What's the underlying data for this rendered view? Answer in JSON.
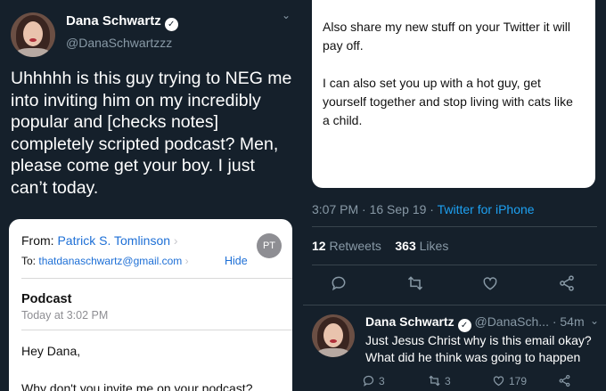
{
  "tweet": {
    "author_name": "Dana Schwartz",
    "author_handle": "@DanaSchwartzzz",
    "text": "Uhhhhh is this guy trying to NEG me into inviting him on my incredibly popular and [checks notes] completely scripted podcast? Men, please come get your boy. I just can’t today."
  },
  "email": {
    "from_label": "From:",
    "from_name": "Patrick S. Tomlinson",
    "from_chevron": "›",
    "to_label": "To:",
    "to_address": "thatdanaschwartz@gmail.com",
    "to_chevron": "›",
    "hide_label": "Hide",
    "avatar_initials": "PT",
    "subject": "Podcast",
    "date": "Today at 3:02 PM",
    "greeting": "Hey Dana,",
    "body_line": "Why don't you invite me on your podcast?",
    "continued_p1": "Also share my new stuff on your Twitter it will pay off.",
    "continued_p2": "I can also set you up with a hot guy, get yourself together and stop living with cats like a child."
  },
  "tweet_meta": {
    "time": "3:07 PM · 16 Sep 19 · ",
    "source": "Twitter for iPhone",
    "retweets_count": "12",
    "retweets_label": "Retweets",
    "likes_count": "363",
    "likes_label": "Likes"
  },
  "reply": {
    "author_name": "Dana Schwartz",
    "meta": "@DanaSch... · 54m",
    "text": "Just Jesus Christ why is this email okay? What did he think was going to happen",
    "reply_count": "3",
    "retweet_count": "3",
    "like_count": "179"
  },
  "icons": {
    "verified_glyph": "✓",
    "caret_glyph": "⌄"
  },
  "colors": {
    "background": "#15202b",
    "link_blue": "#1da1f2",
    "muted": "#8899a6"
  }
}
